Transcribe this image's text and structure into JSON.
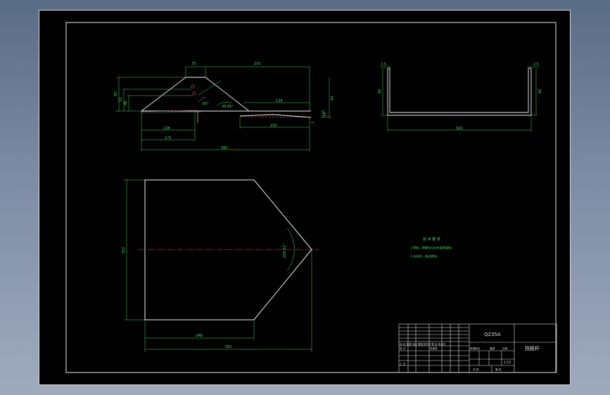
{
  "front_view": {
    "dims": {
      "top_left": "51",
      "top_right": "232",
      "left_outer": "93",
      "left_mid": "53",
      "left_inner": "48",
      "right_height": "93",
      "right_small": "18",
      "angle_left": "65°",
      "angle_mid": "39.05°",
      "width_134": "134",
      "width_150": "150",
      "bottom_138": "138",
      "bottom_175": "175",
      "bottom_total": "582",
      "side_2": "2"
    }
  },
  "side_view": {
    "dims": {
      "thickness_left": "2.5",
      "thickness_right": "2.5",
      "height_left": "60",
      "height_right": "60",
      "width": "322"
    }
  },
  "top_view": {
    "dims": {
      "height": "322",
      "width_248": "248",
      "width_total": "582",
      "angle": "100.02°"
    }
  },
  "notes": {
    "title": "技 术 要 求",
    "line1": "1.焊接，焊缝均匀无夹渣等缺陷；",
    "line2": "2.去毛刺，锐边倒钝。"
  },
  "title_block": {
    "material": "Q235A",
    "part_name": "挡板杆",
    "scale": "1:15",
    "row_labels": "标 记  处数  分区  更改文件号  签 名  年月日",
    "design": "设 计",
    "standard": "标准化",
    "process": "工 艺",
    "stage": "阶段标记",
    "weight": "重量",
    "scale_label": "比例",
    "sheets": "共 张",
    "sheet_no": "第 张"
  }
}
